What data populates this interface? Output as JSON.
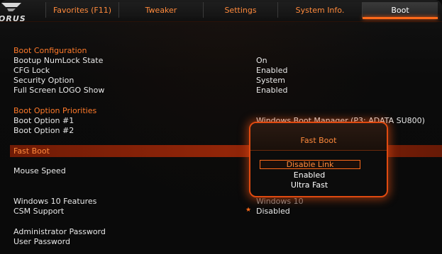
{
  "brand": {
    "logo_text": "ORUS"
  },
  "tabs": [
    {
      "label": "Favorites (F11)"
    },
    {
      "label": "Tweaker"
    },
    {
      "label": "Settings"
    },
    {
      "label": "System Info."
    },
    {
      "label": "Boot"
    }
  ],
  "boot_configuration": {
    "header": "Boot Configuration",
    "items": [
      {
        "label": "Bootup NumLock State",
        "value": "On"
      },
      {
        "label": "CFG Lock",
        "value": "Enabled"
      },
      {
        "label": "Security Option",
        "value": "System"
      },
      {
        "label": "Full Screen LOGO Show",
        "value": "Enabled"
      }
    ]
  },
  "boot_option_priorities": {
    "header": "Boot Option Priorities",
    "items": [
      {
        "label": "Boot Option #1",
        "value": "Windows Boot Manager (P3: ADATA SU800)"
      },
      {
        "label": "Boot Option #2",
        "value": ""
      }
    ]
  },
  "fast_boot": {
    "label": "Fast Boot"
  },
  "mouse_speed": {
    "label": "Mouse Speed"
  },
  "windows_features": {
    "label": "Windows 10 Features",
    "value": "Windows 10"
  },
  "csm_support": {
    "label": "CSM Support",
    "value": "Disabled"
  },
  "admin_password": {
    "label": "Administrator Password"
  },
  "user_password": {
    "label": "User Password"
  },
  "popup": {
    "title": "Fast Boot",
    "options": [
      "Disable Link",
      "Enabled",
      "Ultra Fast"
    ],
    "selected": "Disable Link"
  },
  "colors": {
    "accent": "#ff6a1a",
    "section_header": "#ff7a2a"
  }
}
